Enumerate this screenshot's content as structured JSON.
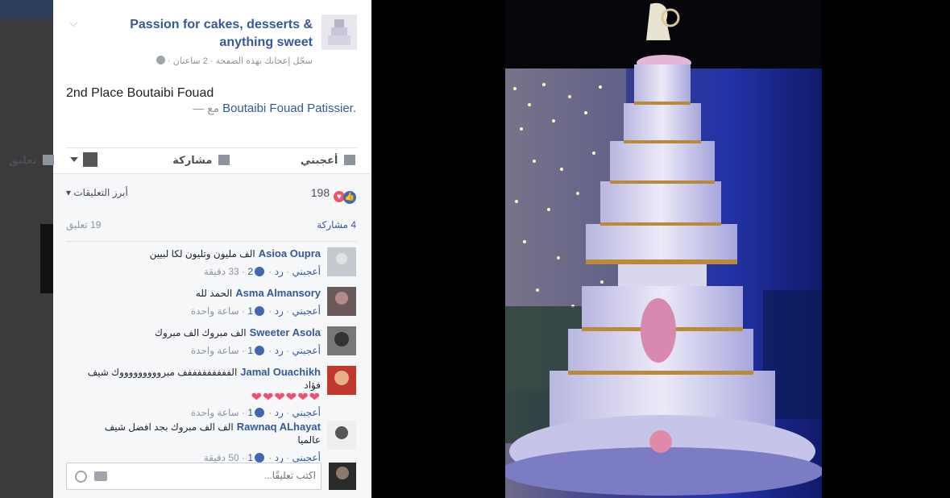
{
  "post": {
    "page_name": "Passion for cakes, desserts & anything sweet",
    "meta": "سجّل إعجابك بهذه الصفحة · 2 ساعتان ·",
    "text": "2nd Place Boutaibi Fouad",
    "with_prefix": "— مع",
    "with_link": "Boutaibi Fouad Patissier."
  },
  "actions": {
    "like": "أعجبني",
    "comment": "تعليق",
    "share": "مشاركة"
  },
  "stats": {
    "reactions": "198",
    "top_comments": "أبرز التعليقات",
    "shares": "4 مشاركة",
    "comments": "19 تعليق"
  },
  "comments": [
    {
      "author": "Asioa Oupra",
      "text": "الف مليون وتليون لكا لبيين",
      "like": "أعجبني",
      "reply": "رد",
      "likes": "2",
      "time": "33 دقيقة"
    },
    {
      "author": "Asma Almansory",
      "text": "الحمد لله",
      "like": "أعجبني",
      "reply": "رد",
      "likes": "1",
      "time": "ساعة واحدة"
    },
    {
      "author": "Sweeter Asola",
      "text": "الف مبروك الف مبروك",
      "like": "أعجبني",
      "reply": "رد",
      "likes": "1",
      "time": "ساعة واحدة"
    },
    {
      "author": "Jamal Ouachikh",
      "text": "الفففففففففف مبروووووووووك شيف فؤاد",
      "hearts": "❤❤❤❤❤❤",
      "like": "أعجبني",
      "reply": "رد",
      "likes": "1",
      "time": "ساعة واحدة"
    },
    {
      "author": "Rawnaq ALhayat",
      "text": "الف الف مبروك بجد افضل شيف عالميا",
      "like": "أعجبني",
      "reply": "رد",
      "likes": "1",
      "time": "50 دقيقة"
    }
  ],
  "composer": {
    "placeholder": "اكتب تعليقًا..."
  },
  "icons": {
    "globe": "globe-icon",
    "chevron": "chevron-down-icon",
    "like": "thumbs-up-icon",
    "comment": "speech-bubble-icon",
    "share": "share-arrow-icon",
    "love": "heart-icon",
    "emoji": "emoji-icon",
    "camera": "camera-icon"
  },
  "colors": {
    "link": "#365899",
    "like_blue": "#4267b2",
    "love_red": "#f25268",
    "photo_bg": "#000000"
  }
}
